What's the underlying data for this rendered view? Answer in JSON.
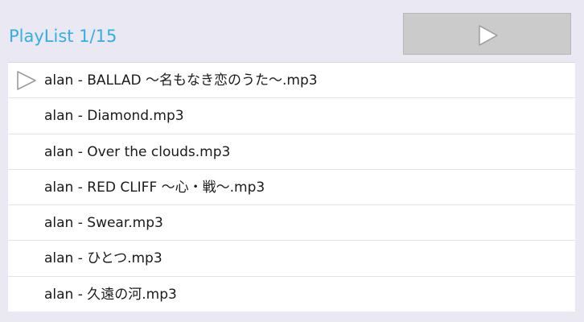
{
  "header": {
    "title": "PlayList 1/15",
    "play_icon": "play-icon"
  },
  "playlist": {
    "items": [
      {
        "label": "alan - BALLAD ～名もなき恋のうた～.mp3",
        "current": true
      },
      {
        "label": "alan - Diamond.mp3",
        "current": false
      },
      {
        "label": "alan - Over the clouds.mp3",
        "current": false
      },
      {
        "label": "alan - RED CLIFF ～心・戦～.mp3",
        "current": false
      },
      {
        "label": "alan - Swear.mp3",
        "current": false
      },
      {
        "label": "alan - ひとつ.mp3",
        "current": false
      },
      {
        "label": "alan - 久遠の河.mp3",
        "current": false
      }
    ],
    "current_marker_icon": "play-outline-icon"
  },
  "colors": {
    "title": "#35aee2",
    "background": "#e9e8f3",
    "button": "#cbcbcb",
    "icon": "#ffffff"
  }
}
